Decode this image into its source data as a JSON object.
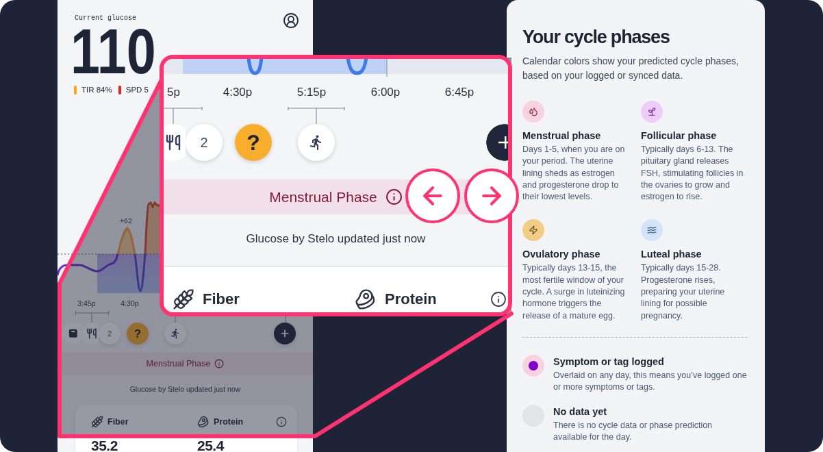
{
  "phone": {
    "glucose_label": "Current glucose",
    "glucose_value": "110",
    "stats": [
      {
        "label": "TIR 84%",
        "color": "#f6a623"
      },
      {
        "label": "SPD 5",
        "color": "#e3261b"
      }
    ],
    "chart": {
      "peak_label": "+62"
    },
    "times": [
      "3:45p",
      "4:30p"
    ],
    "events": [
      {
        "kind": "scale"
      },
      {
        "kind": "meal"
      },
      {
        "kind": "count",
        "text": "2"
      },
      {
        "kind": "prompt",
        "text": "?"
      },
      {
        "kind": "exercise"
      },
      {
        "kind": "add"
      }
    ],
    "phase_banner": "Menstrual Phase",
    "sync_status": "Glucose by Stelo updated just now",
    "nutrients": [
      {
        "kind": "fiber",
        "label": "Fiber",
        "value": "35.2"
      },
      {
        "kind": "protein",
        "label": "Protein",
        "value": "25.4"
      }
    ]
  },
  "magnifier": {
    "times": [
      "5p",
      "4:30p",
      "5:15p",
      "6:00p",
      "6:45p"
    ],
    "events": [
      {
        "kind": "meal"
      },
      {
        "kind": "count",
        "text": "2"
      },
      {
        "kind": "prompt",
        "text": "?"
      },
      {
        "kind": "exercise"
      },
      {
        "kind": "add"
      }
    ],
    "phase_banner": "Menstrual Phase",
    "sync_status": "Glucose by Stelo updated just now",
    "nutrients": [
      {
        "kind": "fiber",
        "label": "Fiber"
      },
      {
        "kind": "protein",
        "label": "Protein"
      }
    ]
  },
  "carousel_arrows": [
    {
      "kind": "previous"
    },
    {
      "kind": "next"
    }
  ],
  "info_panel": {
    "title": "Your cycle phases",
    "intro": "Calendar colors show your predicted cycle phases, based on your logged or synced data.",
    "phases": [
      {
        "kind": "menstrual",
        "name": "Menstrual phase",
        "color": "#f8d3df",
        "description": "Days 1-5, when you are on your period. The uterine lining sheds as estrogen and progesterone drop to their lowest levels."
      },
      {
        "kind": "follicular",
        "name": "Follicular phase",
        "color": "#eecdfa",
        "description": "Typically days 6-13. The pituitary gland releases FSH, stimulating follicles in the ovaries to grow and estrogen to rise."
      },
      {
        "kind": "ovulatory",
        "name": "Ovulatory phase",
        "color": "#f2cd86",
        "description": "Typically days 13-15, the most fertile window of your cycle. A surge in luteinizing hormone triggers the release of a mature egg."
      },
      {
        "kind": "luteal",
        "name": "Luteal phase",
        "color": "#d6e4fb",
        "description": "Typically days 15-28. Progesterone rises, preparing your uterine lining for possible pregnancy."
      }
    ],
    "legend": [
      {
        "kind": "logged",
        "name": "Symptom or tag logged",
        "description": "Overlaid on any day, this means you’ve logged one or more symptoms or tags."
      },
      {
        "kind": "empty",
        "name": "No data yet",
        "description": "There is no cycle data or phase prediction available for the day."
      }
    ]
  }
}
